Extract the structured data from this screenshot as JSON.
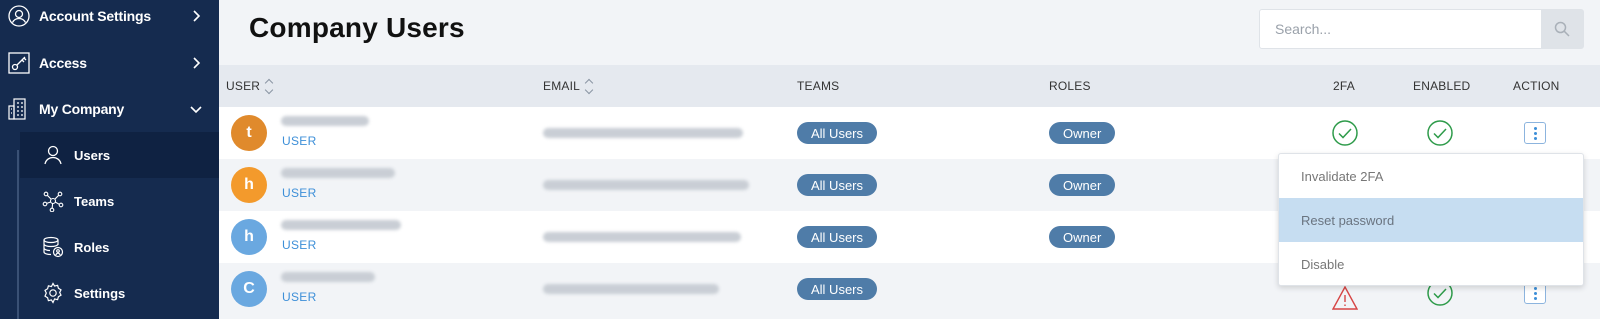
{
  "sidebar": {
    "items": [
      {
        "label": "Account Settings",
        "icon": "user-circle-icon"
      },
      {
        "label": "Access",
        "icon": "key-icon"
      },
      {
        "label": "My Company",
        "icon": "building-icon"
      }
    ],
    "subitems": [
      {
        "label": "Users",
        "icon": "user-icon",
        "active": true
      },
      {
        "label": "Teams",
        "icon": "network-icon"
      },
      {
        "label": "Roles",
        "icon": "database-icon"
      },
      {
        "label": "Settings",
        "icon": "gear-icon"
      }
    ]
  },
  "page": {
    "title": "Company Users",
    "search_placeholder": "Search..."
  },
  "table": {
    "headers": {
      "user": "USER",
      "email": "EMAIL",
      "teams": "TEAMS",
      "roles": "ROLES",
      "twofa": "2FA",
      "enabled": "ENABLED",
      "action": "ACTION"
    },
    "rows": [
      {
        "initial": "t",
        "avatar_color": "#e08a2c",
        "role_label": "USER",
        "team": "All Users",
        "role": "Owner",
        "twofa": "ok",
        "enabled": "ok"
      },
      {
        "initial": "h",
        "avatar_color": "#f39a2c",
        "role_label": "USER",
        "team": "All Users",
        "role": "Owner",
        "twofa": "",
        "enabled": ""
      },
      {
        "initial": "h",
        "avatar_color": "#6aa8e0",
        "role_label": "USER",
        "team": "All Users",
        "role": "Owner",
        "twofa": "",
        "enabled": ""
      },
      {
        "initial": "C",
        "avatar_color": "#6aa8e0",
        "role_label": "USER",
        "team": "All Users",
        "role": "",
        "twofa": "warning",
        "enabled": "ok"
      }
    ]
  },
  "action_menu": {
    "items": [
      "Invalidate 2FA",
      "Reset password",
      "Disable"
    ],
    "highlighted_index": 1
  },
  "colors": {
    "sidebar_bg": "#152b4f",
    "pill_bg": "#4f7ca8",
    "success": "#2e9b4a",
    "warning": "#d64545",
    "accent": "#3d8fd8"
  }
}
